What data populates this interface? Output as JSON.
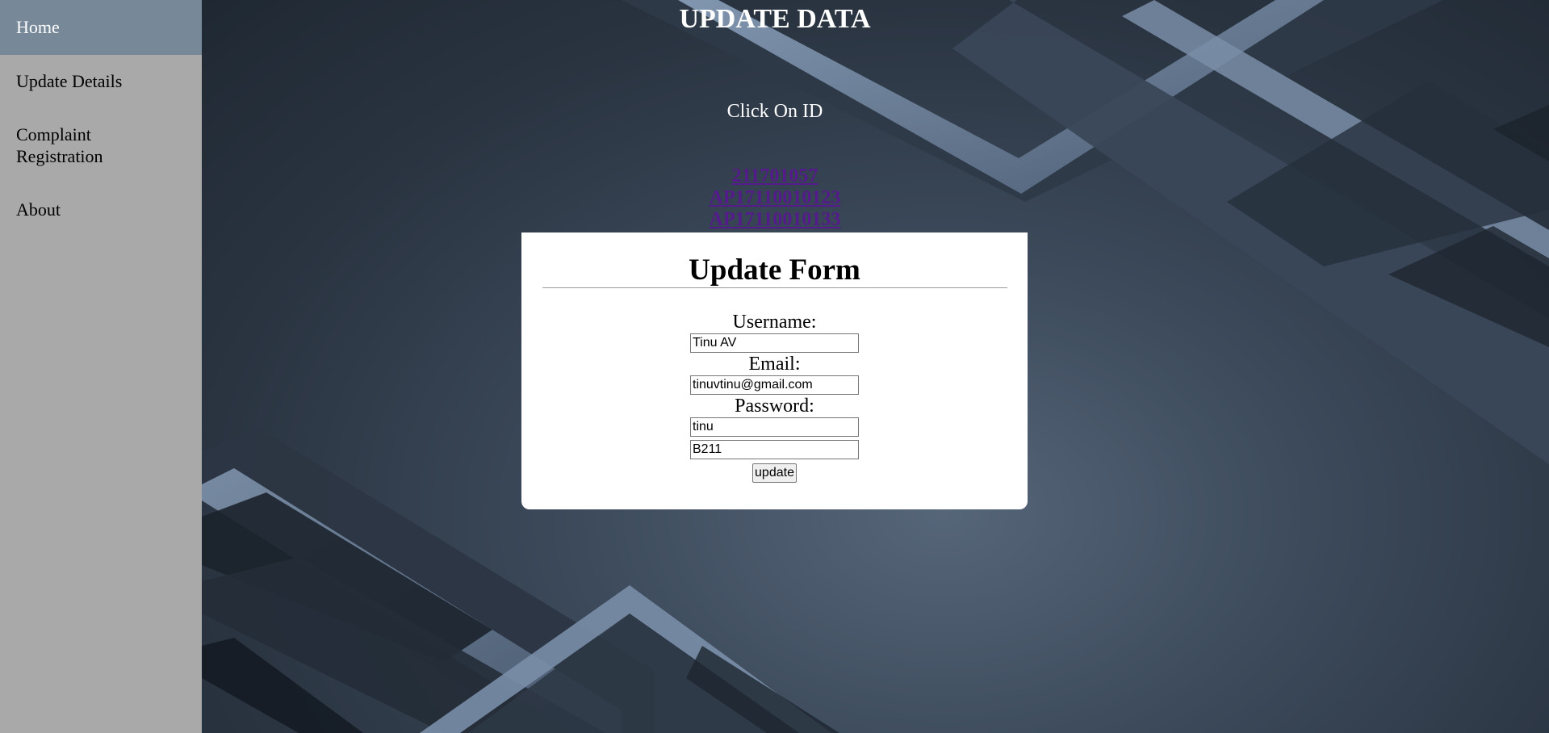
{
  "sidebar": {
    "items": [
      {
        "label": "Home"
      },
      {
        "label": "Update Details"
      },
      {
        "label": "Complaint Registration"
      },
      {
        "label": "About"
      }
    ]
  },
  "main": {
    "title": "UPDATE DATA",
    "instruction": "Click On ID",
    "ids": [
      "211701057",
      "AP17110010123",
      "AP17110010133"
    ]
  },
  "form": {
    "title": "Update Form",
    "username_label": "Username:",
    "username_value": "Tinu AV",
    "email_label": "Email:",
    "email_value": "tinuvtinu@gmail.com",
    "password_label": "Password:",
    "password_value": "tinu",
    "extra_value": "B211",
    "button_label": "update"
  },
  "colors": {
    "sidebar_bg": "#a9a9a9",
    "sidebar_active_bg": "#778899",
    "link_color": "#551a8b"
  }
}
